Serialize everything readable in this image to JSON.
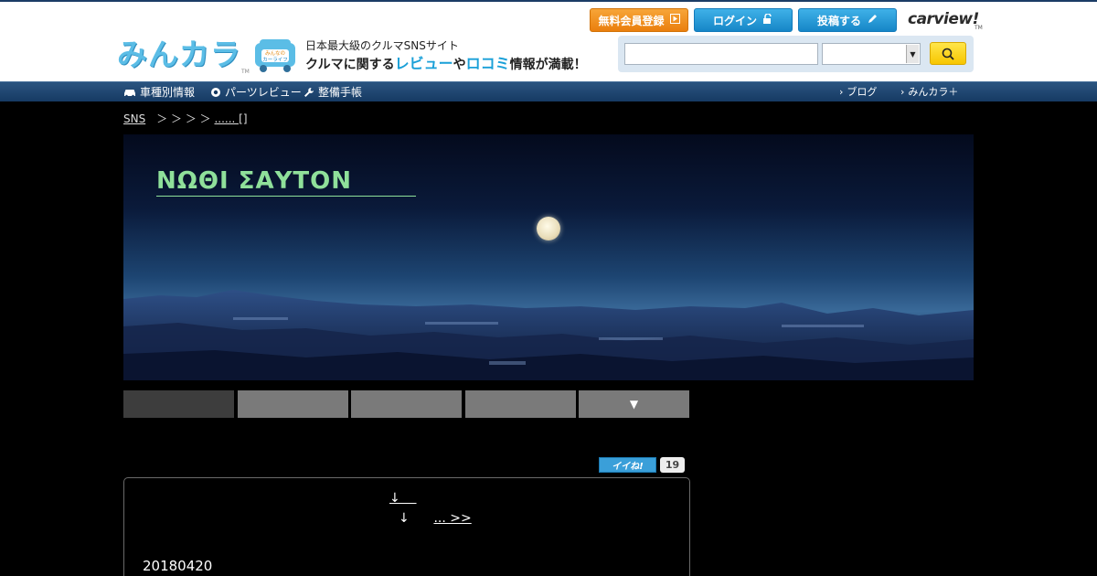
{
  "header": {
    "logo_text": "みんカラ",
    "logo_tm": "TM",
    "mascot_text": "みんなのカーライフ",
    "tagline_1": "日本最大級のクルマSNSサイト",
    "tagline_2a": "クルマに関する",
    "tagline_2b": "レビュー",
    "tagline_2c": "や",
    "tagline_2d": "ロコミ",
    "tagline_2e": "情報が満載！",
    "register_label": "無料会員登録",
    "login_label": "ログイン",
    "post_label": "投稿する",
    "carview_label": "carview!",
    "carview_tm": "TM",
    "search_value": "",
    "select_value": ""
  },
  "gnav": {
    "car_info": "車種別情報",
    "parts_review": "パーツレビュー",
    "maintenance": "整備手帳",
    "blog": "ブログ",
    "minkara_plus": "みんカラ＋"
  },
  "breadcrumb": {
    "sns": "SNS",
    "separators": "　＞ ＞ ＞ ＞ ",
    "current": "...... []"
  },
  "hero": {
    "title": "ΝΩΘΙ ΣΑΥΤΟΝ"
  },
  "tabs": {
    "more_label": "▼"
  },
  "iine": {
    "label": "イイね!",
    "count": "19"
  },
  "post": {
    "line1": "↓    ",
    "line2_arrow": "↓",
    "line2_more": "... >>",
    "date": "20180420"
  },
  "colors": {
    "header_nav_bg": "#1b3c66",
    "title_green": "#8fe09a",
    "accent_orange": "#ea7f0d",
    "accent_blue": "#1686c7"
  }
}
